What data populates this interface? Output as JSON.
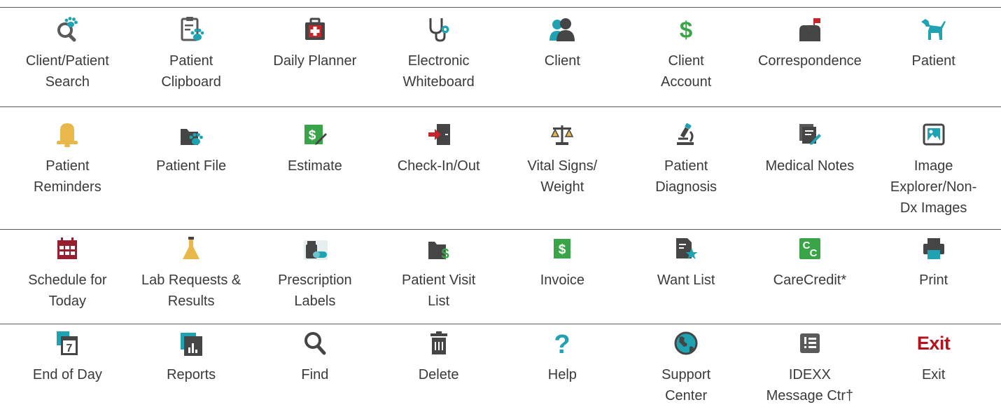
{
  "colors": {
    "teal": "#1fa3b3",
    "dark": "#454545",
    "green": "#3aa548",
    "red": "#c8242b",
    "bell": "#e8b84a",
    "maroon": "#9a1f2e",
    "divider": "#5a5a5a"
  },
  "rows": [
    {
      "items": [
        {
          "label": "Client/Patient\nSearch",
          "icon": "search-paw-icon"
        },
        {
          "label": "Patient\nClipboard",
          "icon": "clipboard-paw-icon"
        },
        {
          "label": "Daily Planner",
          "icon": "medical-bag-icon"
        },
        {
          "label": "Electronic\nWhiteboard",
          "icon": "stethoscope-icon"
        },
        {
          "label": "Client",
          "icon": "client-people-icon"
        },
        {
          "label": "Client\nAccount",
          "icon": "dollar-icon"
        },
        {
          "label": "Correspondence",
          "icon": "mailbox-icon"
        },
        {
          "label": "Patient",
          "icon": "dog-icon"
        }
      ]
    },
    {
      "items": [
        {
          "label": "Patient\nReminders",
          "icon": "bell-icon"
        },
        {
          "label": "Patient File",
          "icon": "folder-paw-icon"
        },
        {
          "label": "Estimate",
          "icon": "estimate-pencil-icon"
        },
        {
          "label": "Check-In/Out",
          "icon": "check-in-door-icon"
        },
        {
          "label": "Vital Signs/\nWeight",
          "icon": "scale-icon"
        },
        {
          "label": "Patient\nDiagnosis",
          "icon": "microscope-icon"
        },
        {
          "label": "Medical Notes",
          "icon": "notes-pencil-icon"
        },
        {
          "label": "Image\nExplorer/Non-\nDx Images",
          "icon": "image-icon"
        }
      ]
    },
    {
      "items": [
        {
          "label": "Schedule for\nToday",
          "icon": "calendar-icon"
        },
        {
          "label": "Lab Requests &\nResults",
          "icon": "flask-icon"
        },
        {
          "label": "Prescription\nLabels",
          "icon": "pill-bottle-icon"
        },
        {
          "label": "Patient  Visit\nList",
          "icon": "folder-dollar-icon"
        },
        {
          "label": "Invoice",
          "icon": "invoice-icon"
        },
        {
          "label": "Want List",
          "icon": "list-star-icon"
        },
        {
          "label": "CareCredit*",
          "icon": "carecredit-icon"
        },
        {
          "label": "Print",
          "icon": "printer-icon"
        }
      ]
    },
    {
      "items": [
        {
          "label": "End of Day",
          "icon": "end-of-day-calendar-icon"
        },
        {
          "label": "Reports",
          "icon": "reports-chart-icon"
        },
        {
          "label": "Find",
          "icon": "magnifier-icon"
        },
        {
          "label": "Delete",
          "icon": "trash-icon"
        },
        {
          "label": "Help",
          "icon": "question-icon"
        },
        {
          "label": "Support\nCenter",
          "icon": "globe-icon"
        },
        {
          "label": "IDEXX\nMessage Ctr†",
          "icon": "message-center-icon"
        },
        {
          "label": "Exit",
          "icon": "exit-icon",
          "icon_text": "Exit"
        }
      ]
    }
  ]
}
